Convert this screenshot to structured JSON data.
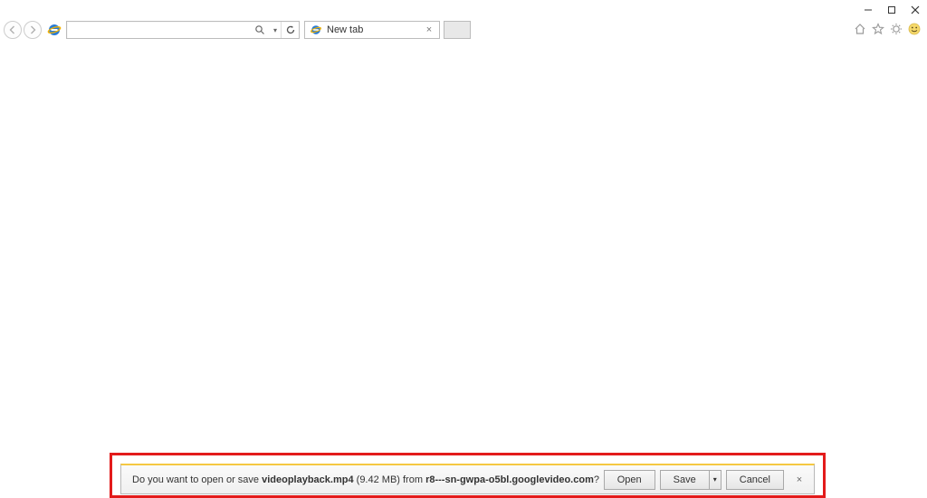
{
  "window": {
    "minimize": "─",
    "maximize": "▢",
    "close": "✕"
  },
  "nav": {
    "address_value": "",
    "search_glyph": "⌕",
    "dropdown_glyph": "▾",
    "refresh_glyph": "↻"
  },
  "tab": {
    "title": "New tab",
    "close_glyph": "×"
  },
  "command_bar": {
    "home": "⌂",
    "favorites": "☆",
    "tools": "⚙",
    "smiley": "☺"
  },
  "notify": {
    "pre_text": "Do you want to open or save ",
    "filename": "videoplayback.mp4",
    "size_text": " (9.42 MB) ",
    "from_text": "from ",
    "host": "r8---sn-gwpa-o5bl.googlevideo.com",
    "q": "?",
    "open_label": "Open",
    "save_label": "Save",
    "save_arrow": "▾",
    "cancel_label": "Cancel",
    "close_glyph": "×"
  }
}
